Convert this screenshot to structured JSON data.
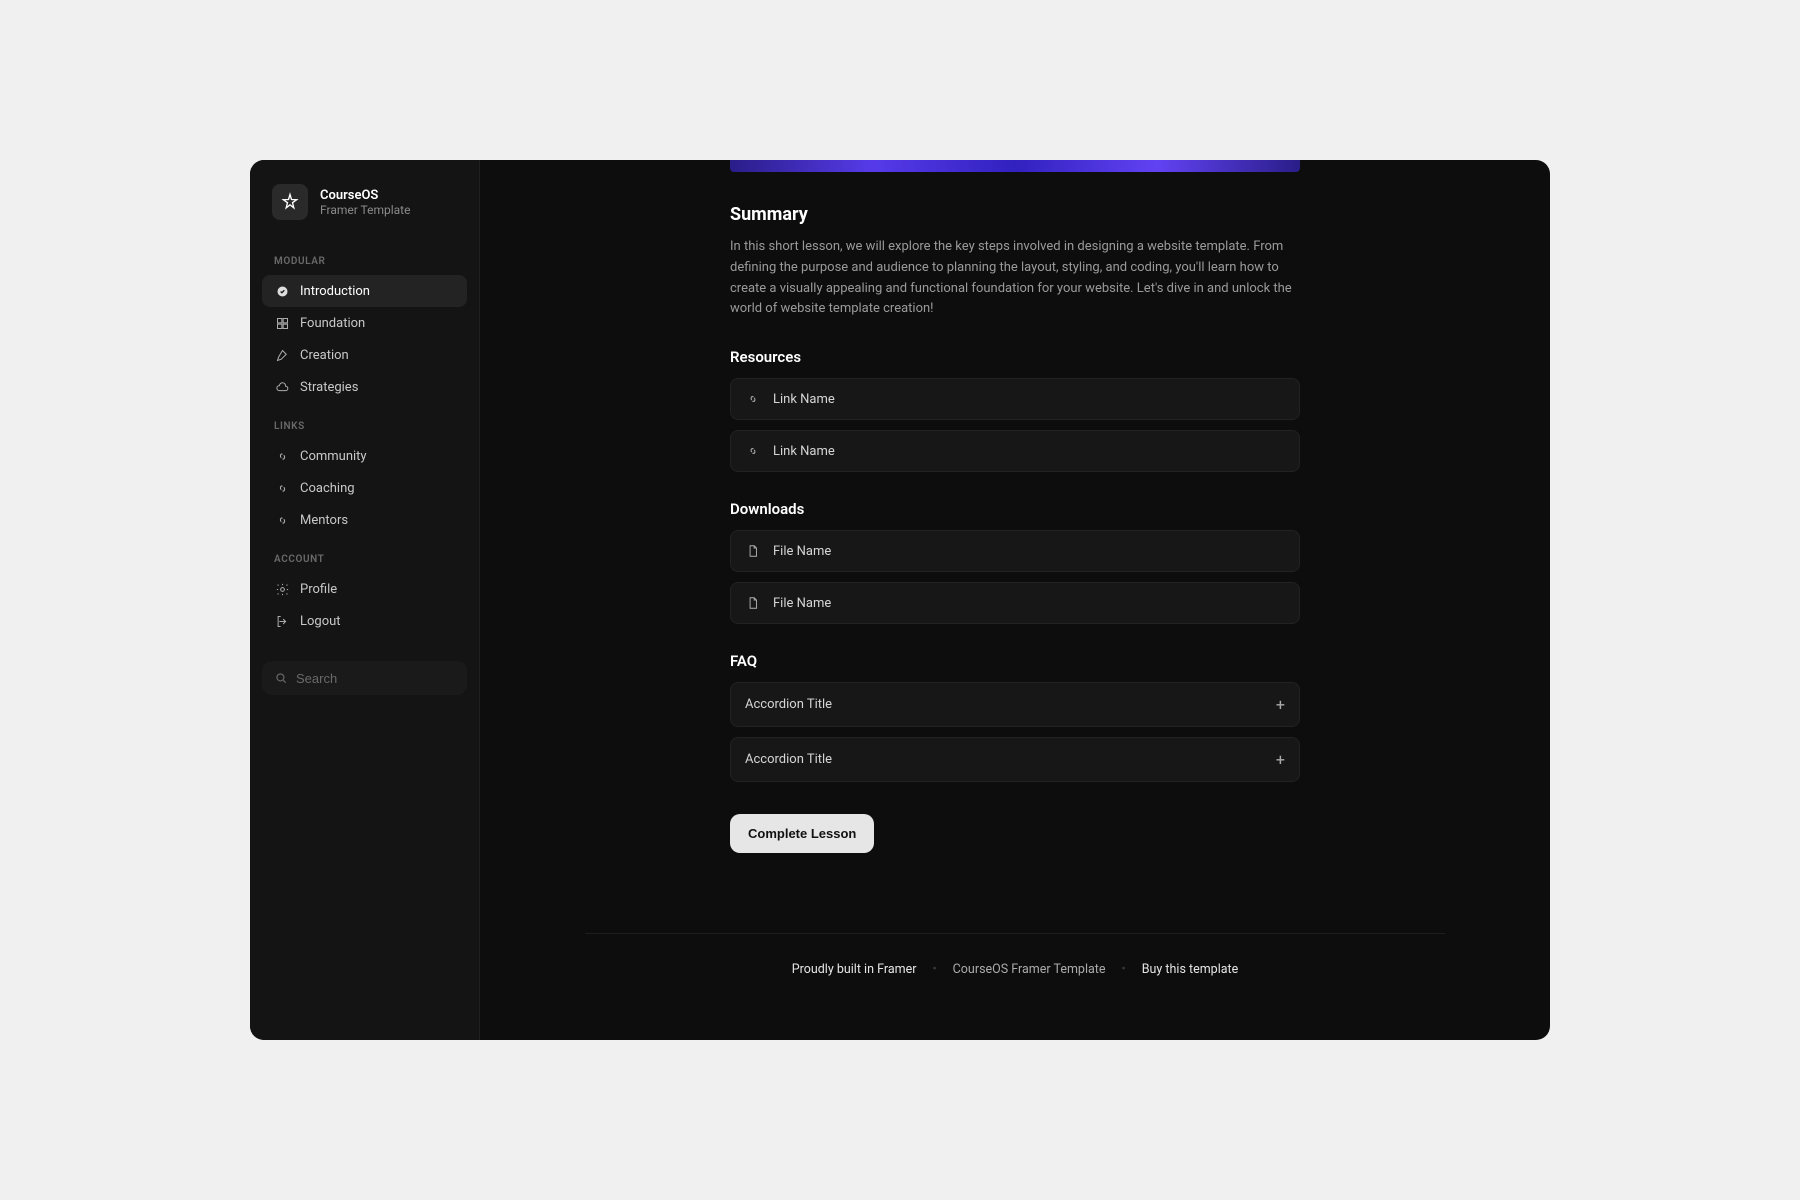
{
  "brand": {
    "title": "CourseOS",
    "subtitle": "Framer Template"
  },
  "sidebar": {
    "sections": {
      "modular": {
        "label": "MODULAR",
        "items": [
          {
            "label": "Introduction"
          },
          {
            "label": "Foundation"
          },
          {
            "label": "Creation"
          },
          {
            "label": "Strategies"
          }
        ]
      },
      "links": {
        "label": "LINKS",
        "items": [
          {
            "label": "Community"
          },
          {
            "label": "Coaching"
          },
          {
            "label": "Mentors"
          }
        ]
      },
      "account": {
        "label": "ACCOUNT",
        "items": [
          {
            "label": "Profile"
          },
          {
            "label": "Logout"
          }
        ]
      }
    }
  },
  "search": {
    "placeholder": "Search"
  },
  "summary": {
    "heading": "Summary",
    "body": "In this short lesson, we will explore the key steps involved in designing a website template. From defining the purpose and audience to planning the layout, styling, and coding, you'll learn how to create a visually appealing and functional foundation for your website. Let's dive in and unlock the world of website template creation!"
  },
  "resources": {
    "heading": "Resources",
    "items": [
      {
        "label": "Link Name"
      },
      {
        "label": "Link Name"
      }
    ]
  },
  "downloads": {
    "heading": "Downloads",
    "items": [
      {
        "label": "File Name"
      },
      {
        "label": "File Name"
      }
    ]
  },
  "faq": {
    "heading": "FAQ",
    "items": [
      {
        "label": "Accordion Title"
      },
      {
        "label": "Accordion Title"
      }
    ]
  },
  "cta": {
    "label": "Complete Lesson"
  },
  "footer": {
    "built": "Proudly built in Framer",
    "template": "CourseOS Framer Template",
    "buy": "Buy this template"
  }
}
